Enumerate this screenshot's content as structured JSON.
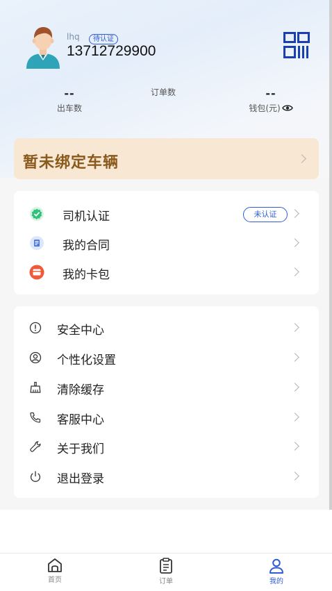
{
  "profile": {
    "username": "lhq",
    "status_tag": "待认证",
    "phone": "13712729900"
  },
  "stats": {
    "trips_value": "--",
    "trips_label": "出车数",
    "orders_label": "订单数",
    "wallet_value": "--",
    "wallet_label": "钱包(元)"
  },
  "vehicle_banner": {
    "text": "暂未绑定车辆"
  },
  "card_primary": {
    "items": [
      {
        "label": "司机认证",
        "icon": "verified-badge-icon",
        "badge": "未认证"
      },
      {
        "label": "我的合同",
        "icon": "contract-icon"
      },
      {
        "label": "我的卡包",
        "icon": "card-wallet-icon"
      }
    ]
  },
  "card_settings": {
    "items": [
      {
        "label": "安全中心",
        "icon": "alert-circle-icon"
      },
      {
        "label": "个性化设置",
        "icon": "user-circle-icon"
      },
      {
        "label": "清除缓存",
        "icon": "broom-icon"
      },
      {
        "label": "客服中心",
        "icon": "phone-icon"
      },
      {
        "label": "关于我们",
        "icon": "wrench-icon"
      },
      {
        "label": "退出登录",
        "icon": "power-icon"
      }
    ]
  },
  "tabbar": {
    "tabs": [
      {
        "label": "首页",
        "icon": "home-icon"
      },
      {
        "label": "订单",
        "icon": "order-list-icon"
      },
      {
        "label": "我的",
        "icon": "person-icon",
        "active": true
      }
    ]
  },
  "colors": {
    "accent": "#2f5cd6",
    "banner_bg": "#f8e7d2",
    "banner_text": "#8a5a1d"
  }
}
